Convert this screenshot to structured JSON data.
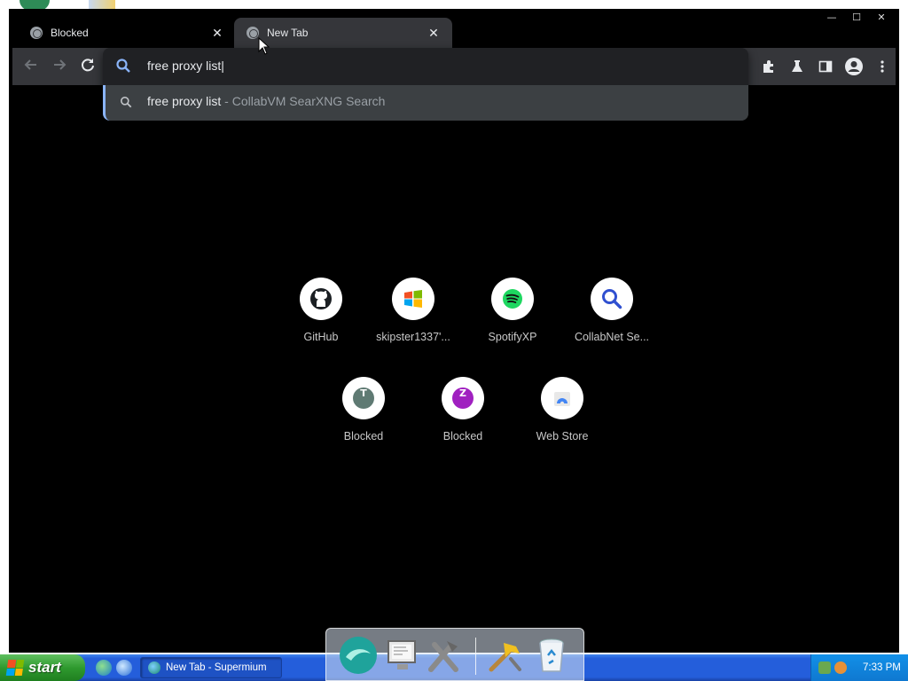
{
  "tabs": [
    {
      "label": "Blocked",
      "active": false
    },
    {
      "label": "New Tab",
      "active": true
    }
  ],
  "window_controls": {
    "minimize": "—",
    "maximize": "☐",
    "close": "✕"
  },
  "tab_close_glyph": "✕",
  "omnibox": {
    "value": "free proxy list",
    "suggestion": {
      "query": "free proxy list",
      "separator": " - ",
      "description": "CollabVM SearXNG Search"
    }
  },
  "shortcuts": [
    {
      "label": "GitHub",
      "icon": "github-icon"
    },
    {
      "label": "skipster1337'...",
      "icon": "windows-logo-icon"
    },
    {
      "label": "SpotifyXP",
      "icon": "spotify-icon"
    },
    {
      "label": "CollabNet Se...",
      "icon": "search-icon"
    },
    {
      "label": "Blocked",
      "icon": "letter-t-icon",
      "letter": "T",
      "color": "#5f7a73"
    },
    {
      "label": "Blocked",
      "icon": "letter-z-icon",
      "letter": "Z",
      "color": "#a020c0"
    },
    {
      "label": "Web Store",
      "icon": "web-store-icon"
    }
  ],
  "taskbar": {
    "start_label": "start",
    "task_label": "New Tab - Supermium",
    "clock": "7:33 PM"
  },
  "colors": {
    "toolbar_bg": "#35363a",
    "accent": "#8ab4f8",
    "search_icon_blue": "#8ab4f8"
  }
}
